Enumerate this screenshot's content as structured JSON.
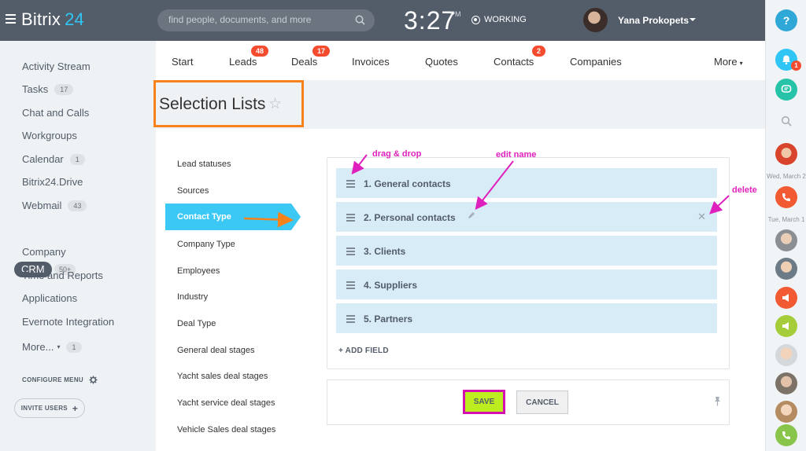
{
  "header": {
    "logo_text": "Bitrix",
    "logo_num": "24",
    "search_placeholder": "find people, documents, and more",
    "time": "3:27",
    "ampm": "PM",
    "status": "WORKING",
    "user_name": "Yana Prokopets"
  },
  "sidebar": {
    "items": [
      {
        "label": "Activity Stream",
        "count": ""
      },
      {
        "label": "Tasks",
        "count": "17"
      },
      {
        "label": "Chat and Calls",
        "count": ""
      },
      {
        "label": "Workgroups",
        "count": ""
      },
      {
        "label": "Calendar",
        "count": "1"
      },
      {
        "label": "Bitrix24.Drive",
        "count": ""
      },
      {
        "label": "Webmail",
        "count": "43"
      },
      {
        "label": "CRM",
        "count": "50+"
      },
      {
        "label": "Company",
        "count": ""
      },
      {
        "label": "Time and Reports",
        "count": ""
      },
      {
        "label": "Applications",
        "count": ""
      },
      {
        "label": "Evernote Integration",
        "count": ""
      },
      {
        "label": "More...",
        "count": "1"
      }
    ],
    "configure_menu": "CONFIGURE MENU",
    "invite_users": "INVITE USERS"
  },
  "tabs": [
    {
      "label": "Start",
      "badge": ""
    },
    {
      "label": "Leads",
      "badge": "48"
    },
    {
      "label": "Deals",
      "badge": "17"
    },
    {
      "label": "Invoices",
      "badge": ""
    },
    {
      "label": "Quotes",
      "badge": ""
    },
    {
      "label": "Contacts",
      "badge": "2"
    },
    {
      "label": "Companies",
      "badge": ""
    },
    {
      "label": "More",
      "badge": ""
    }
  ],
  "page": {
    "title": "Selection Lists",
    "star": "☆"
  },
  "list_nav": {
    "items": [
      "Lead statuses",
      "Sources",
      "Contact Type",
      "Company Type",
      "Employees",
      "Industry",
      "Deal Type",
      "General deal stages",
      "Yacht sales deal stages",
      "Yacht service deal stages",
      "Vehicle Sales deal stages"
    ],
    "active": "Contact Type"
  },
  "fields": [
    "1. General contacts",
    "2. Personal contacts",
    "3. Clients",
    "4. Suppliers",
    "5. Partners"
  ],
  "add_field": "+ ADD FIELD",
  "buttons": {
    "save": "SAVE",
    "cancel": "CANCEL"
  },
  "annotations": {
    "drag_drop": "drag & drop",
    "edit_name": "edit name",
    "delete": "delete"
  },
  "right_bar": {
    "notification_count": "1",
    "help": "?",
    "date1": "Wed, March 2",
    "date2": "Tue, March 1"
  },
  "colors": {
    "topbar": "#535c69",
    "accent_blue": "#3bc8f5",
    "badge_red": "#f54b2f",
    "annotation_pink": "#e020bd",
    "annotation_orange": "#f7821a",
    "save_green": "#bbed21"
  }
}
